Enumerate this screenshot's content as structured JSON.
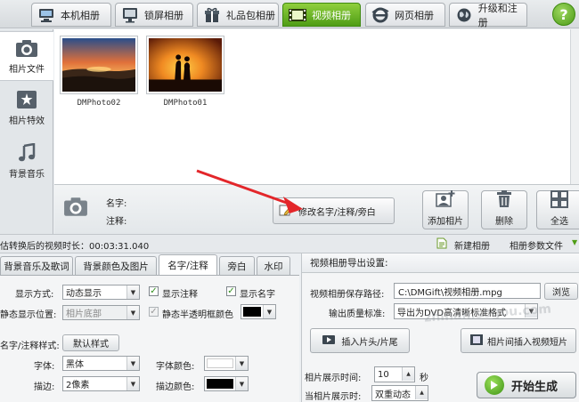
{
  "top_tabs": [
    {
      "label": "本机相册",
      "icon": "computer-icon"
    },
    {
      "label": "锁屏相册",
      "icon": "monitor-icon"
    },
    {
      "label": "礼品包相册",
      "icon": "gift-icon"
    },
    {
      "label": "视频相册",
      "icon": "film-icon",
      "active": true
    },
    {
      "label": "网页相册",
      "icon": "ie-icon"
    },
    {
      "label": "升级和注册",
      "icon": "globe-icon"
    }
  ],
  "help_label": "?",
  "sidebar": {
    "items": [
      {
        "label": "相片文件",
        "icon": "camera-icon",
        "active": true
      },
      {
        "label": "相片特效",
        "icon": "effects-icon"
      },
      {
        "label": "背景音乐",
        "icon": "music-note-icon"
      }
    ]
  },
  "photos": [
    {
      "name": "DMPhoto02"
    },
    {
      "name": "DMPhoto01"
    }
  ],
  "info": {
    "name_label": "名字:",
    "note_label": "注释:",
    "edit_button": "修改名字/注释/旁白",
    "add_photo": "添加相片",
    "delete": "删除",
    "select_all": "全选"
  },
  "status": {
    "duration_label": "估转换后的视频时长：00:03:31.040",
    "new_album": "新建相册",
    "album_params": "相册参数文件"
  },
  "bottom_tabs": [
    "背景音乐及歌词",
    "背景颜色及图片",
    "名字/注释",
    "旁白",
    "水印"
  ],
  "left_panel": {
    "display_mode_label": "显示方式:",
    "display_mode_value": "动态显示",
    "show_note_label": "显示注释",
    "show_name_label": "显示名字",
    "static_pos_label": "静态显示位置:",
    "static_pos_value": "相片底部",
    "translucent_label": "静态半透明框颜色",
    "style_label": "名字/注释样式:",
    "default_style_button": "默认样式",
    "font_label": "字体:",
    "font_value": "黑体",
    "font_color_label": "字体颜色:",
    "stroke_label": "描边:",
    "stroke_value": "2像素",
    "stroke_color_label": "描边颜色:",
    "translucent_color": "#000000",
    "font_color": "#ffffff",
    "stroke_color": "#000000"
  },
  "right_panel": {
    "header": "视频相册导出设置:",
    "save_path_label": "视频相册保存路径:",
    "save_path_value": "C:\\DMGift\\视频相册.mpg",
    "browse_button": "浏览",
    "quality_label": "输出质量标准:",
    "quality_value": "导出为DVD高清晰标准格式",
    "insert_clip_button": "插入片头/片尾",
    "insert_between_button": "相片间插入视频短片",
    "show_time_label": "相片展示时间:",
    "show_time_value": "10",
    "show_time_unit": "秒",
    "show_mode_label": "当相片展示时:",
    "show_mode_value": "双重动态",
    "start_button": "开始生成"
  },
  "watermark": "zhinan.sogou.com"
}
